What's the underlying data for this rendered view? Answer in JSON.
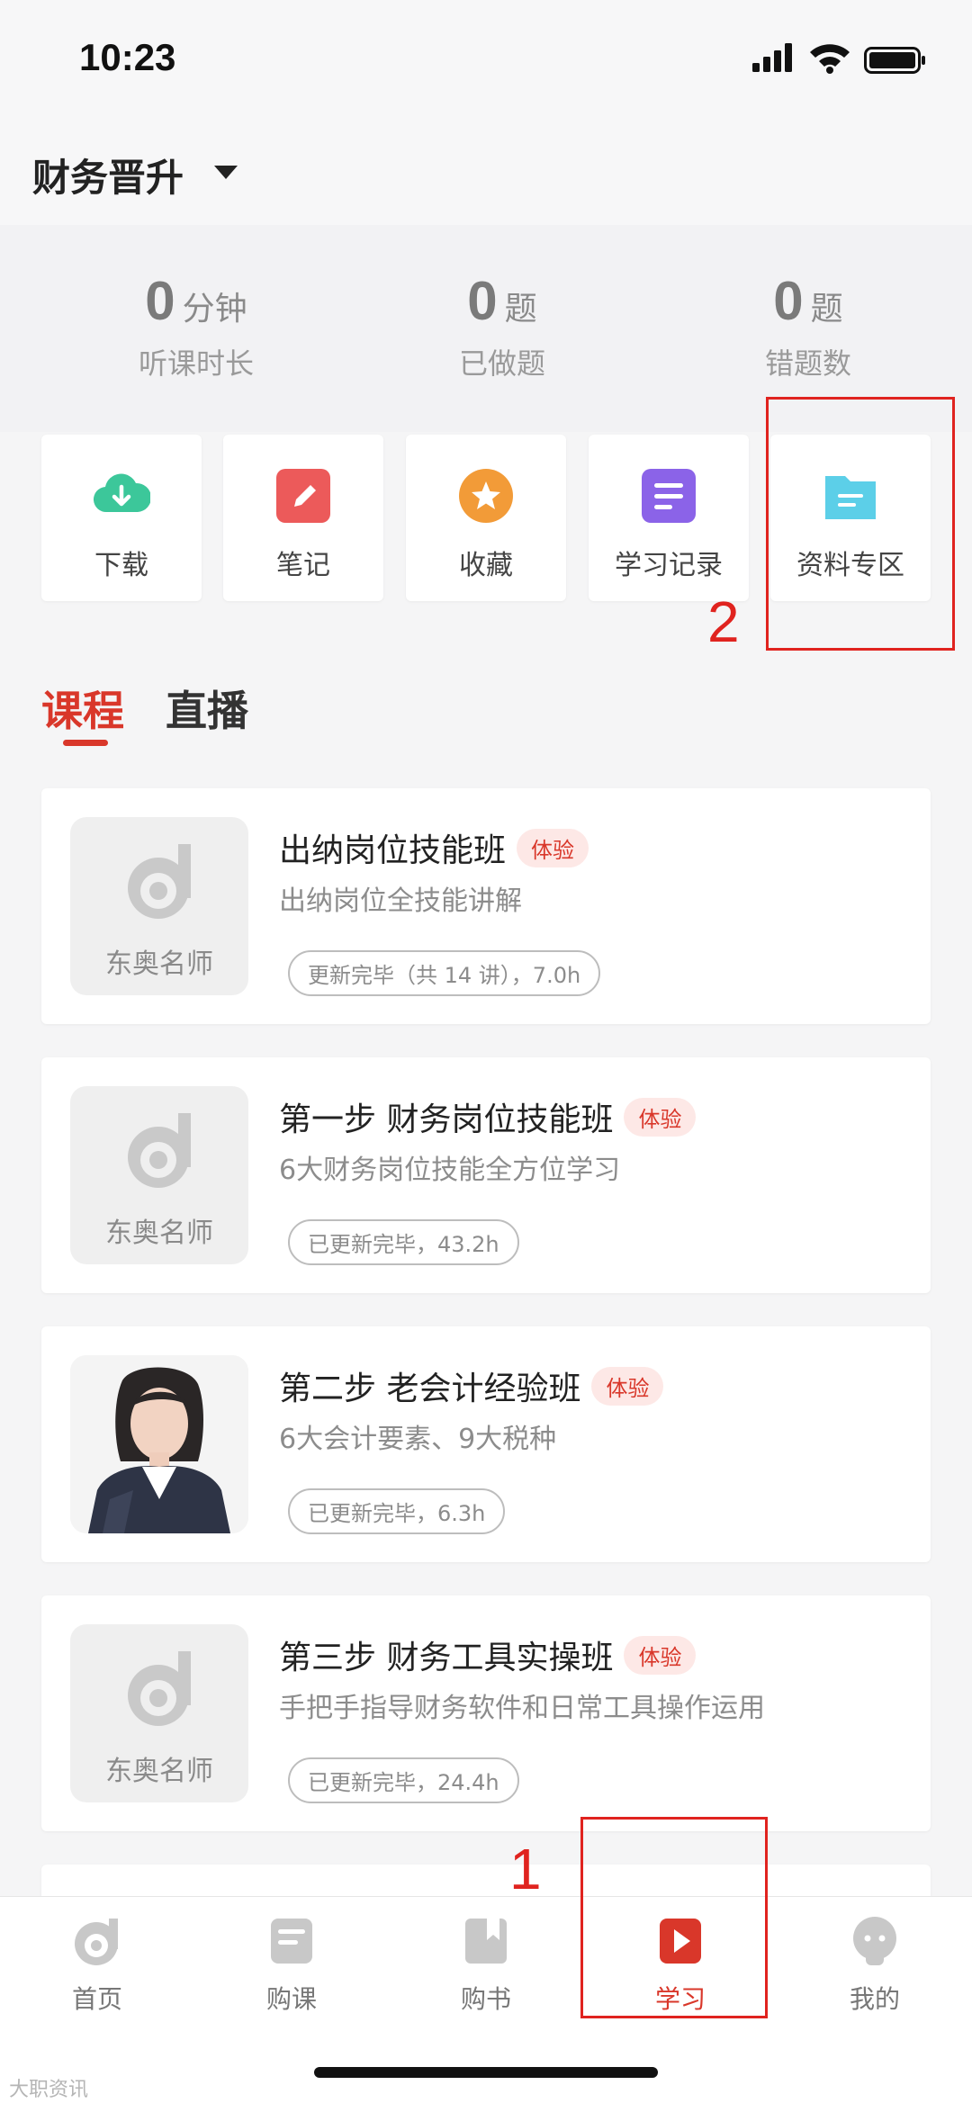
{
  "status_bar": {
    "time": "10:23"
  },
  "header": {
    "title": "财务晋升"
  },
  "stats": [
    {
      "value": "0",
      "unit": "分钟",
      "label": "听课时长"
    },
    {
      "value": "0",
      "unit": "题",
      "label": "已做题"
    },
    {
      "value": "0",
      "unit": "题",
      "label": "错题数"
    }
  ],
  "quick_actions": [
    {
      "label": "下载",
      "icon": "download-icon",
      "color": "#3cc79a"
    },
    {
      "label": "笔记",
      "icon": "note-pencil-icon",
      "color": "#ec5a5a"
    },
    {
      "label": "收藏",
      "icon": "star-icon",
      "color": "#f29b38"
    },
    {
      "label": "学习记录",
      "icon": "record-list-icon",
      "color": "#8b63e8"
    },
    {
      "label": "资料专区",
      "icon": "folder-icon",
      "color": "#5ccfe8"
    }
  ],
  "annotations": {
    "first": "1",
    "second": "2"
  },
  "tabs": [
    {
      "label": "课程",
      "active": true
    },
    {
      "label": "直播",
      "active": false
    }
  ],
  "courses": [
    {
      "title": "出纳岗位技能班",
      "badge": "体验",
      "subtitle": "出纳岗位全技能讲解",
      "status": "更新完毕（共 14 讲），7.0h",
      "thumb_caption": "东奥名师"
    },
    {
      "title": "第一步 财务岗位技能班",
      "badge": "体验",
      "subtitle": "6大财务岗位技能全方位学习",
      "status": "已更新完毕，43.2h",
      "thumb_caption": "东奥名师"
    },
    {
      "title": "第二步 老会计经验班",
      "badge": "体验",
      "subtitle": "6大会计要素、9大税种",
      "status": "已更新完毕，6.3h",
      "thumb_caption": ""
    },
    {
      "title": "第三步 财务工具实操班",
      "badge": "体验",
      "subtitle": "手把手指导财务软件和日常工具操作运用",
      "status": "已更新完毕，24.4h",
      "thumb_caption": "东奥名师"
    }
  ],
  "bottom_nav": [
    {
      "label": "首页",
      "icon": "home-logo-icon",
      "active": false
    },
    {
      "label": "购课",
      "icon": "buy-course-icon",
      "active": false
    },
    {
      "label": "购书",
      "icon": "buy-book-icon",
      "active": false
    },
    {
      "label": "学习",
      "icon": "study-play-icon",
      "active": true
    },
    {
      "label": "我的",
      "icon": "profile-icon",
      "active": false
    }
  ],
  "colors": {
    "accent": "#d9372a",
    "annotation": "#e0231f"
  },
  "watermark": "大职资讯"
}
